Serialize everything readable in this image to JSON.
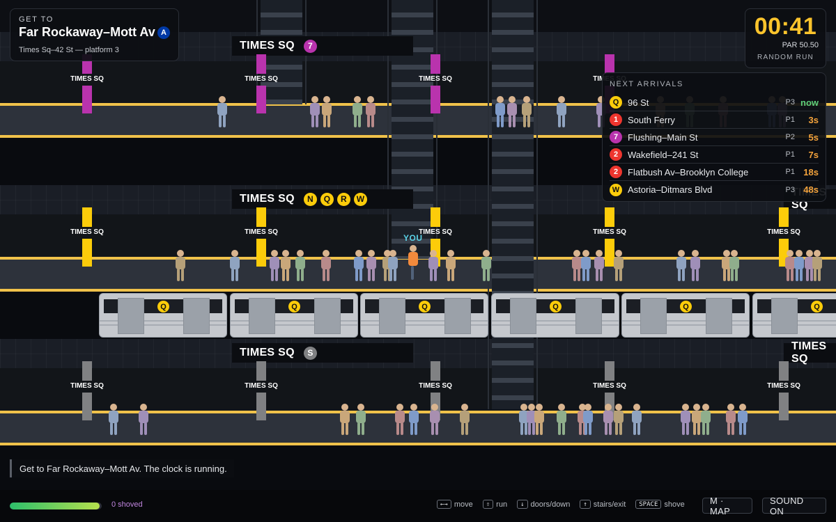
{
  "goal": {
    "kicker": "GET TO",
    "destination": "Far Rockaway–Mott Av",
    "line": "A",
    "line_color": "#0039a6",
    "subtitle": "Times Sq–42 St — platform 3"
  },
  "timer": {
    "value": "00:41",
    "par": "PAR 50.50",
    "mode": "RANDOM RUN"
  },
  "arrivals": {
    "title": "NEXT ARRIVALS",
    "rows": [
      {
        "line": "Q",
        "color": "#fccc0a",
        "text_color": "#111111",
        "destination": "96 St",
        "platform": "P3",
        "eta": "now"
      },
      {
        "line": "1",
        "color": "#ee352e",
        "text_color": "#ffffff",
        "destination": "South Ferry",
        "platform": "P1",
        "eta": "3s"
      },
      {
        "line": "7",
        "color": "#b933ad",
        "text_color": "#ffffff",
        "destination": "Flushing–Main St",
        "platform": "P2",
        "eta": "5s"
      },
      {
        "line": "2",
        "color": "#ee352e",
        "text_color": "#ffffff",
        "destination": "Wakefield–241 St",
        "platform": "P1",
        "eta": "7s"
      },
      {
        "line": "2",
        "color": "#ee352e",
        "text_color": "#ffffff",
        "destination": "Flatbush Av–Brooklyn College",
        "platform": "P1",
        "eta": "18s"
      },
      {
        "line": "W",
        "color": "#fccc0a",
        "text_color": "#111111",
        "destination": "Astoria–Ditmars Blvd",
        "platform": "P3",
        "eta": "48s"
      }
    ]
  },
  "station": {
    "signs": [
      {
        "text": "TIMES SQ",
        "lines": [
          "7"
        ],
        "bullet_class": "b-purple"
      },
      {
        "text": "TIMES SQ",
        "lines": [
          "N",
          "Q",
          "R",
          "W"
        ],
        "bullet_class": "b-yellow"
      },
      {
        "text": "TIMES SQ",
        "lines": [
          "S"
        ],
        "bullet_class": "b-gray"
      }
    ],
    "edge_signs": [
      "TIMES SQ",
      "TIMES SQ",
      "TIMES SQ"
    ],
    "pillar_label": "TIMES SQ",
    "train_line": "Q",
    "player_label": "YOU",
    "level_colors": [
      "#b933ad",
      "#fccc0a",
      "#808183"
    ]
  },
  "message": "Get to Far Rockaway–Mott Av. The clock is running.",
  "status": {
    "progress_fraction": 0.98,
    "shoved": "0 shoved"
  },
  "controls": [
    {
      "key": "←→",
      "label": "move"
    },
    {
      "key": "⇧",
      "label": "run"
    },
    {
      "key": "↓",
      "label": "doors/down"
    },
    {
      "key": "↑",
      "label": "stairs/exit"
    },
    {
      "key": "SPACE",
      "label": "shove"
    }
  ],
  "buttons": {
    "map": "M · MAP",
    "sound": "SOUND ON"
  }
}
